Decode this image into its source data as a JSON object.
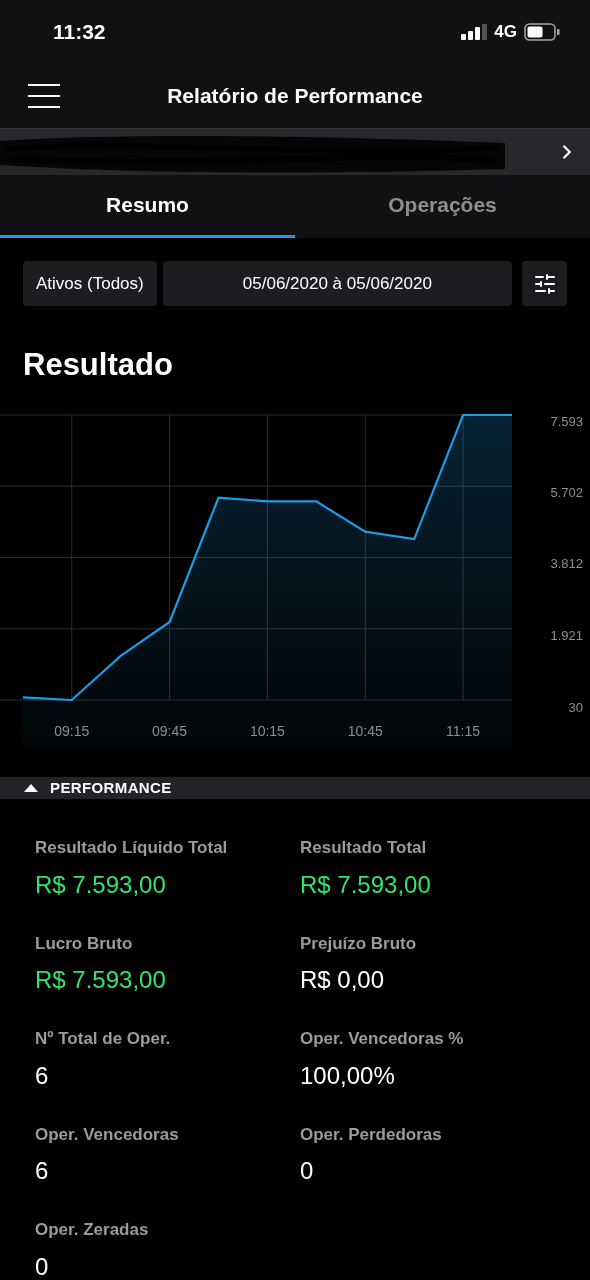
{
  "status_bar": {
    "time": "11:32",
    "network": "4G"
  },
  "header": {
    "title": "Relatório de Performance"
  },
  "account_bar": {
    "redacted": true
  },
  "tabs": [
    {
      "label": "Resumo",
      "selected": true
    },
    {
      "label": "Operações",
      "selected": false
    }
  ],
  "filters": {
    "assets": "Ativos (Todos)",
    "date_range": "05/06/2020 à 05/06/2020"
  },
  "result": {
    "title": "Resultado",
    "chart_data": {
      "type": "area",
      "x": [
        540,
        555,
        570,
        585,
        600,
        615,
        630,
        645,
        660,
        675,
        690
      ],
      "series": [
        {
          "color": "#1e9be6",
          "values": [
            100,
            30,
            1200,
            2100,
            5400,
            5300,
            5300,
            4500,
            4300,
            7593,
            7593
          ]
        }
      ],
      "grid": true,
      "xlim": [
        533,
        690
      ],
      "ylim": [
        30,
        7593
      ],
      "xticks": [
        {
          "value": 555,
          "label": "09:15"
        },
        {
          "value": 585,
          "label": "09:45"
        },
        {
          "value": 615,
          "label": "10:15"
        },
        {
          "value": 645,
          "label": "10:45"
        },
        {
          "value": 675,
          "label": "11:15"
        }
      ],
      "yticks": [
        {
          "value": 30,
          "label": "30"
        },
        {
          "value": 1921,
          "label": "1.921"
        },
        {
          "value": 3812,
          "label": "3.812"
        },
        {
          "value": 5702,
          "label": "5.702"
        },
        {
          "value": 7593,
          "label": "7.593"
        }
      ]
    }
  },
  "performance": {
    "title": "PERFORMANCE",
    "expanded": true,
    "metrics": [
      {
        "label": "Resultado Líquido Total",
        "value": "R$ 7.593,00",
        "positive": true
      },
      {
        "label": "Resultado Total",
        "value": "R$ 7.593,00",
        "positive": true
      },
      {
        "label": "Lucro Bruto",
        "value": "R$ 7.593,00",
        "positive": true
      },
      {
        "label": "Prejuízo Bruto",
        "value": "R$ 0,00",
        "positive": false
      },
      {
        "label": "Nº Total de Oper.",
        "value": "6",
        "positive": false
      },
      {
        "label": "Oper. Vencedoras %",
        "value": "100,00%",
        "positive": false
      },
      {
        "label": "Oper. Vencedoras",
        "value": "6",
        "positive": false
      },
      {
        "label": "Oper. Perdedoras",
        "value": "0",
        "positive": false
      },
      {
        "label": "Oper. Zeradas",
        "value": "0",
        "positive": false
      }
    ]
  }
}
